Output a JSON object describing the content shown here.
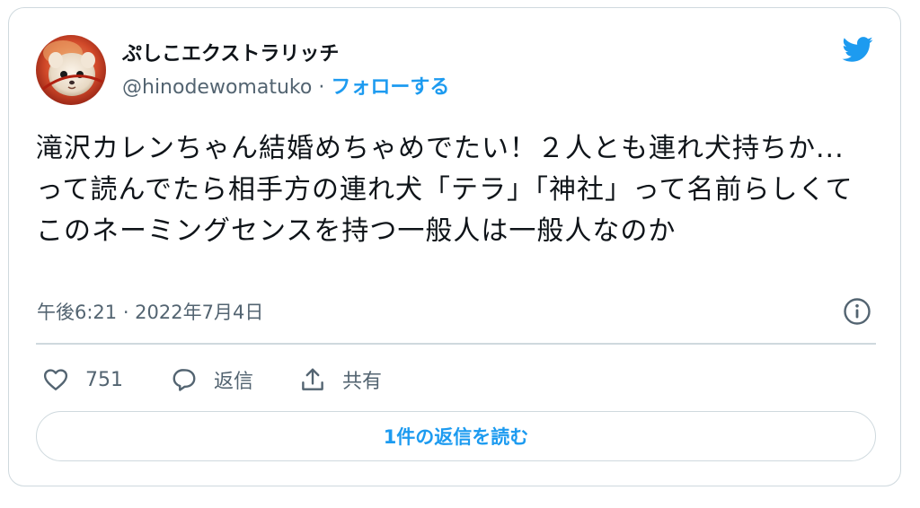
{
  "author": {
    "display_name": "ぷしこエクストラリッチ",
    "handle": "@hinodewomatuko",
    "separator": "·",
    "follow_label": "フォローする",
    "avatar_icon": "avatar-photo-icon"
  },
  "tweet": {
    "text": "滝沢カレンちゃん結婚めちゃめでたい！２人とも連れ犬持ちか...って読んでたら相手方の連れ犬「テラ」「神社」って名前らしくてこのネーミングセンスを持つ一般人は一般人なのか",
    "timestamp": "午後6:21 · 2022年7月4日"
  },
  "actions": {
    "like_count": "751",
    "reply_label": "返信",
    "share_label": "共有",
    "like_icon": "heart-icon",
    "reply_icon": "speech-bubble-icon",
    "share_icon": "share-upload-icon"
  },
  "footer": {
    "read_replies_label": "1件の返信を読む"
  },
  "colors": {
    "accent": "#1d9bf0",
    "text_primary": "#0f1419",
    "text_secondary": "#536471",
    "border": "#cfd9de"
  },
  "icons": {
    "logo": "twitter-bird-icon",
    "info": "info-icon"
  }
}
